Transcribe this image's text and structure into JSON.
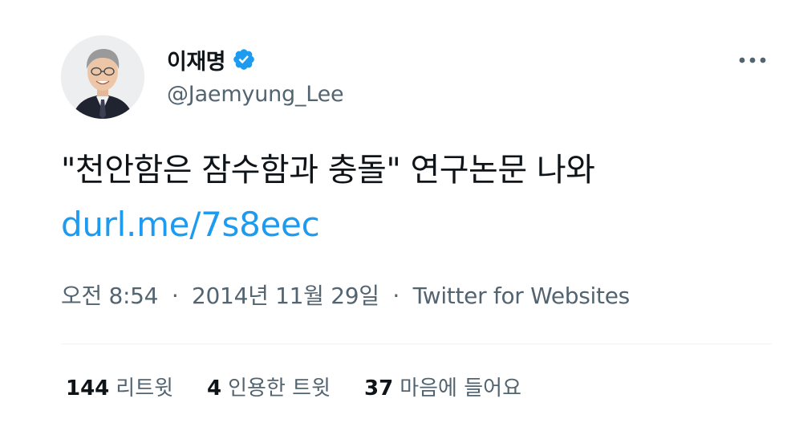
{
  "tweet": {
    "author": {
      "display_name": "이재명",
      "handle": "@Jaemyung_Lee",
      "verified": true
    },
    "text": "\"천안함은 잠수함과 충돌\" 연구논문 나와",
    "link": "durl.me/7s8eec",
    "time": "오전 8:54",
    "date": "2014년 11월 29일",
    "separator": "·",
    "source": "Twitter for Websites",
    "stats": [
      {
        "count": "144",
        "label": "리트윗"
      },
      {
        "count": "4",
        "label": "인용한 트윗"
      },
      {
        "count": "37",
        "label": "마음에 들어요"
      }
    ]
  },
  "icons": {
    "verified": "verified-badge-icon",
    "more": "more-dots-icon"
  },
  "colors": {
    "link": "#1d9bf0",
    "secondary_text": "#536471",
    "primary_text": "#0f1419",
    "divider": "#eff3f4"
  }
}
